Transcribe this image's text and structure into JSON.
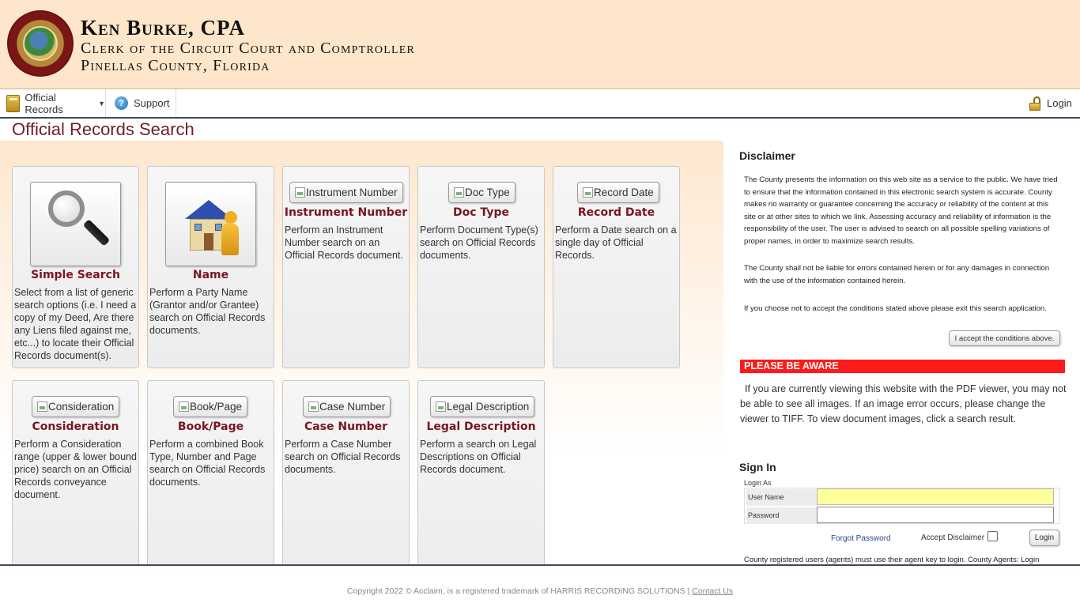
{
  "header": {
    "name": "Ken Burke, CPA",
    "office": "Clerk of the Circuit Court and Comptroller",
    "county": "Pinellas County, Florida"
  },
  "nav": {
    "records_label": "Official Records",
    "support_label": "Support",
    "login_label": "Login"
  },
  "page_title": "Official Records Search",
  "tiles": [
    {
      "button": "",
      "title": "Simple Search",
      "desc": "Select from a list of generic search options (i.e. I need a copy of my Deed, Are there any Liens filed against me, etc...) to locate their Official Records document(s).",
      "icon": "magnifier-icon"
    },
    {
      "button": "",
      "title": "Name",
      "desc": "Perform a Party Name (Grantor and/or Grantee) search on Official Records documents.",
      "icon": "house-person-icon"
    },
    {
      "button": "Instrument Number",
      "title": "Instrument Number",
      "desc": "Perform an Instrument Number search on an Official Records document."
    },
    {
      "button": "Doc Type",
      "title": "Doc Type",
      "desc": "Perform Document Type(s) search on Official Records documents."
    },
    {
      "button": "Record Date",
      "title": "Record Date",
      "desc": "Perform a Date search on a single day of Official Records."
    },
    {
      "button": "Consideration",
      "title": "Consideration",
      "desc": "Perform a Consideration range (upper & lower bound price) search on an Official Records conveyance document."
    },
    {
      "button": "Book/Page",
      "title": "Book/Page",
      "desc": "Perform a combined Book Type, Number and Page search on Official Records documents."
    },
    {
      "button": "Case Number",
      "title": "Case Number",
      "desc": "Perform a Case Number search on Official Records documents."
    },
    {
      "button": "Legal Description",
      "title": "Legal Description",
      "desc": "Perform a search on Legal Descriptions on Official Records document."
    }
  ],
  "disclaimer": {
    "title": "Disclaimer",
    "p1": "The County presents the information on this web site as a service to the public. We have tried to ensure that the information contained in this electronic search system is accurate. County makes no warranty or guarantee concerning the accuracy or reliability of the content at this site or at other sites to which we link. Assessing accuracy and reliability of information is the responsibility of the user. The user is advised to search on all possible spelling variations of proper names, in order to maximize search results.",
    "p2": "The County shall not be liable for errors contained herein or for any damages in connection with the use of the information contained herein.",
    "p3": "If you choose not to accept the conditions stated above please exit this search application.",
    "accept_button": "I accept the conditions above."
  },
  "aware": {
    "title": "PLEASE BE AWARE",
    "text": "If you are currently viewing this website with the PDF viewer, you may not be able to see all images. If an image error occurs, please change the viewer to TIFF. To view document images, click a search result."
  },
  "signin": {
    "title": "Sign In",
    "login_as": "Login As",
    "username_label": "User Name",
    "password_label": "Password",
    "username_value": "",
    "password_value": "",
    "forgot": "Forgot Password",
    "accept_disclaimer": "Accept Disclaimer",
    "login_button": "Login",
    "agent_note": "County registered users (agents) must use their agent key to login. County Agents: Login"
  },
  "footer": {
    "copyright": "Copyright 2022 © Acclaim, is a registered trademark of HARRIS RECORDING SOLUTIONS | ",
    "contact": "Contact Us"
  }
}
